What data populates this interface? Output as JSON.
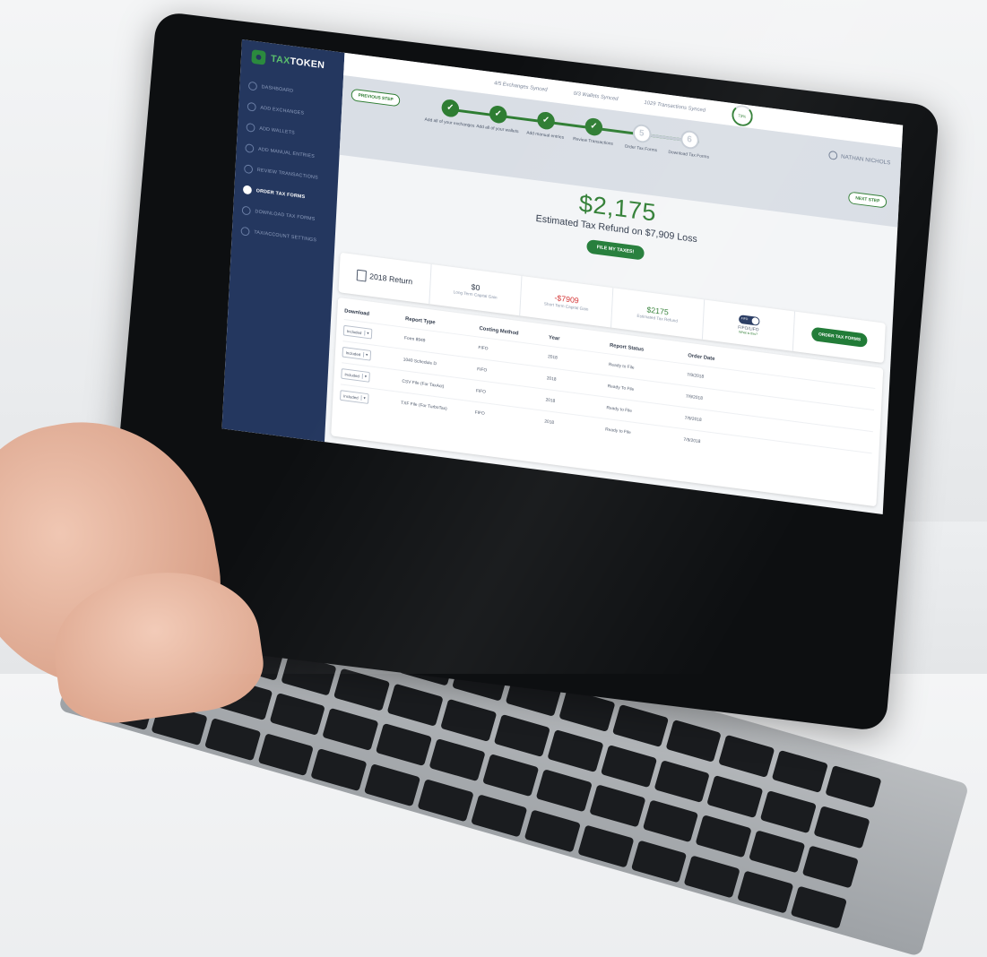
{
  "app": {
    "logo_prefix": "TAX",
    "logo_suffix": "TOKEN"
  },
  "sidebar": {
    "items": [
      {
        "label": "Dashboard"
      },
      {
        "label": "Add Exchanges"
      },
      {
        "label": "Add Wallets"
      },
      {
        "label": "Add Manual Entries"
      },
      {
        "label": "Review Transactions"
      },
      {
        "label": "Order Tax Forms",
        "active": true
      },
      {
        "label": "Download Tax Forms"
      },
      {
        "label": "Tax/Account Settings"
      }
    ]
  },
  "topbar": {
    "exchanges": "4/5 Exchanges Synced",
    "wallets": "0/3 Wallets Synced",
    "transactions": "1029 Transactions Synced",
    "progress": "73%"
  },
  "user": {
    "name": "Nathan Nichols"
  },
  "stepper": {
    "prev_label": "Previous Step",
    "next_label": "Next Step",
    "steps": [
      {
        "label": "Add all of your exchanges",
        "mark": "✓",
        "done": true
      },
      {
        "label": "Add all of your wallets",
        "mark": "✓",
        "done": true
      },
      {
        "label": "Add manual entries",
        "mark": "✓",
        "done": true
      },
      {
        "label": "Review Transactions",
        "mark": "✓",
        "done": true
      },
      {
        "label": "Order Tax Forms",
        "mark": "5",
        "done": false
      },
      {
        "label": "Download Tax Forms",
        "mark": "6",
        "done": false
      }
    ]
  },
  "refund": {
    "amount": "$2,175",
    "caption": "Estimated Tax Refund on $7,909 Loss",
    "file_button": "File My Taxes!"
  },
  "summary": {
    "year_label": "2018 Return",
    "long_term_value": "$0",
    "long_term_label": "Long Term Capital Gain",
    "short_term_value": "-$7909",
    "short_term_label": "Short Term Capital Gain",
    "refund_value": "$2175",
    "refund_label": "Estimated Tax Refund",
    "toggle_label": "FIFO",
    "method_label": "FIFO/LIFO",
    "method_sub": "What is this?",
    "order_button": "Order Tax Forms"
  },
  "table": {
    "headers": [
      "Download",
      "Report Type",
      "Costing Method",
      "Year",
      "Report Status",
      "Order Date"
    ],
    "rows": [
      {
        "download": "Included",
        "type": "Form 8949",
        "method": "FIFO",
        "year": "2018",
        "status": "Ready to File",
        "date": "7/9/2018"
      },
      {
        "download": "Included",
        "type": "1040 Schedule D",
        "method": "FIFO",
        "year": "2018",
        "status": "Ready To File",
        "date": "7/9/2018"
      },
      {
        "download": "Included",
        "type": "CSV File (For TaxAct)",
        "method": "FIFO",
        "year": "2018",
        "status": "Ready to File",
        "date": "7/9/2018"
      },
      {
        "download": "Included",
        "type": "TXF File (For TurboTax)",
        "method": "FIFO",
        "year": "2018",
        "status": "Ready to File",
        "date": "7/9/2018"
      }
    ]
  },
  "colors": {
    "brand_green": "#2e7d32",
    "sidebar_navy": "#24375f",
    "loss_red": "#d32f2f"
  }
}
